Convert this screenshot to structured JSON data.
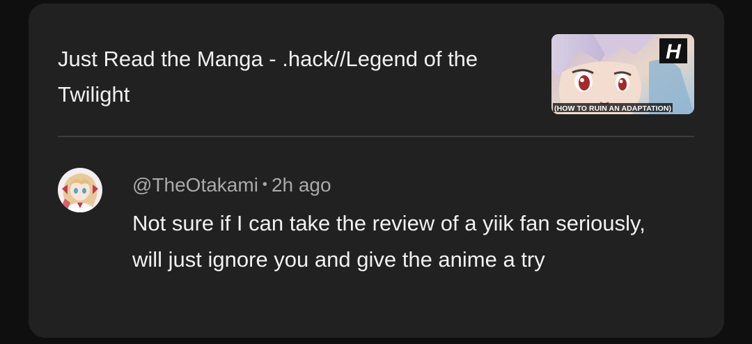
{
  "video": {
    "title": "Just Read the Manga - .hack//Legend of the Twilight",
    "thumbnail_caption": "(HOW TO RUIN AN ADAPTATION)",
    "thumbnail_logo": "H"
  },
  "comment": {
    "author": "@TheOtakami",
    "separator": "•",
    "time": "2h ago",
    "text": "Not sure if I can take the review of a yiik fan seriously, will just ignore you and give the anime a try"
  },
  "colors": {
    "background": "#0f0f0f",
    "card": "#212121",
    "primary_text": "#f1f1f1",
    "secondary_text": "#aaaaaa",
    "divider": "#3d3d3d"
  },
  "icons": {
    "thumbnail": "anime-face-thumbnail",
    "avatar": "anime-girl-avatar"
  }
}
